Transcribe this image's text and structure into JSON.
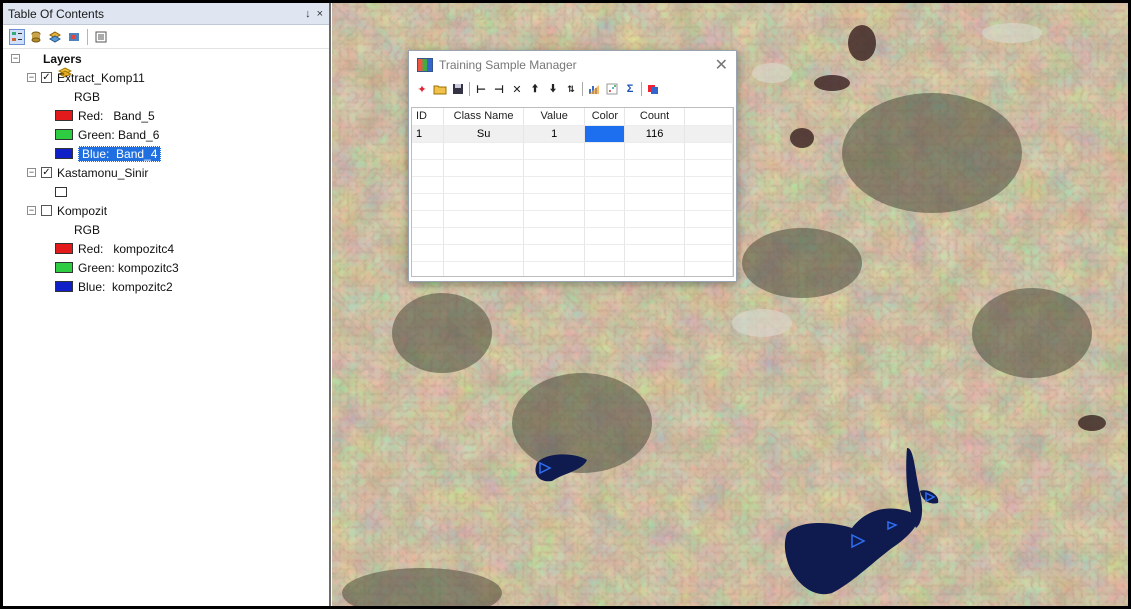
{
  "toc": {
    "title": "Table Of Contents",
    "pin_label": "↓",
    "close_label": "×",
    "toolbar_icons": [
      "list-by-drawing-order-icon",
      "list-by-source-icon",
      "list-by-visibility-icon",
      "list-by-selection-icon",
      "options-icon"
    ],
    "root": {
      "label": "Layers"
    },
    "layers": [
      {
        "name": "Extract_Komp11",
        "checked": true,
        "check_glyph": "✓",
        "sub": "RGB",
        "bands": [
          {
            "label": "Red:   Band_5",
            "color": "#e31a1c"
          },
          {
            "label": "Green: Band_6",
            "color": "#2ecc40"
          },
          {
            "label": "Blue:  Band_4",
            "color": "#1020c8"
          }
        ]
      },
      {
        "name": "Kastamonu_Sinir",
        "checked": true,
        "check_glyph": "✓"
      },
      {
        "name": "Kompozit",
        "checked": false,
        "check_glyph": "",
        "sub": "RGB",
        "bands": [
          {
            "label": "Red:   kompozitc4",
            "color": "#e31a1c"
          },
          {
            "label": "Green: kompozitc3",
            "color": "#2ecc40"
          },
          {
            "label": "Blue:  kompozitc2",
            "color": "#1020c8"
          }
        ]
      }
    ]
  },
  "dialog": {
    "title": "Training Sample Manager",
    "close_label": "✕",
    "columns": [
      "ID",
      "Class Name",
      "Value",
      "Color",
      "Count"
    ],
    "rows": [
      {
        "id": "1",
        "class_name": "Su",
        "value": "1",
        "color": "#1e6ff0",
        "count": "116"
      }
    ]
  }
}
